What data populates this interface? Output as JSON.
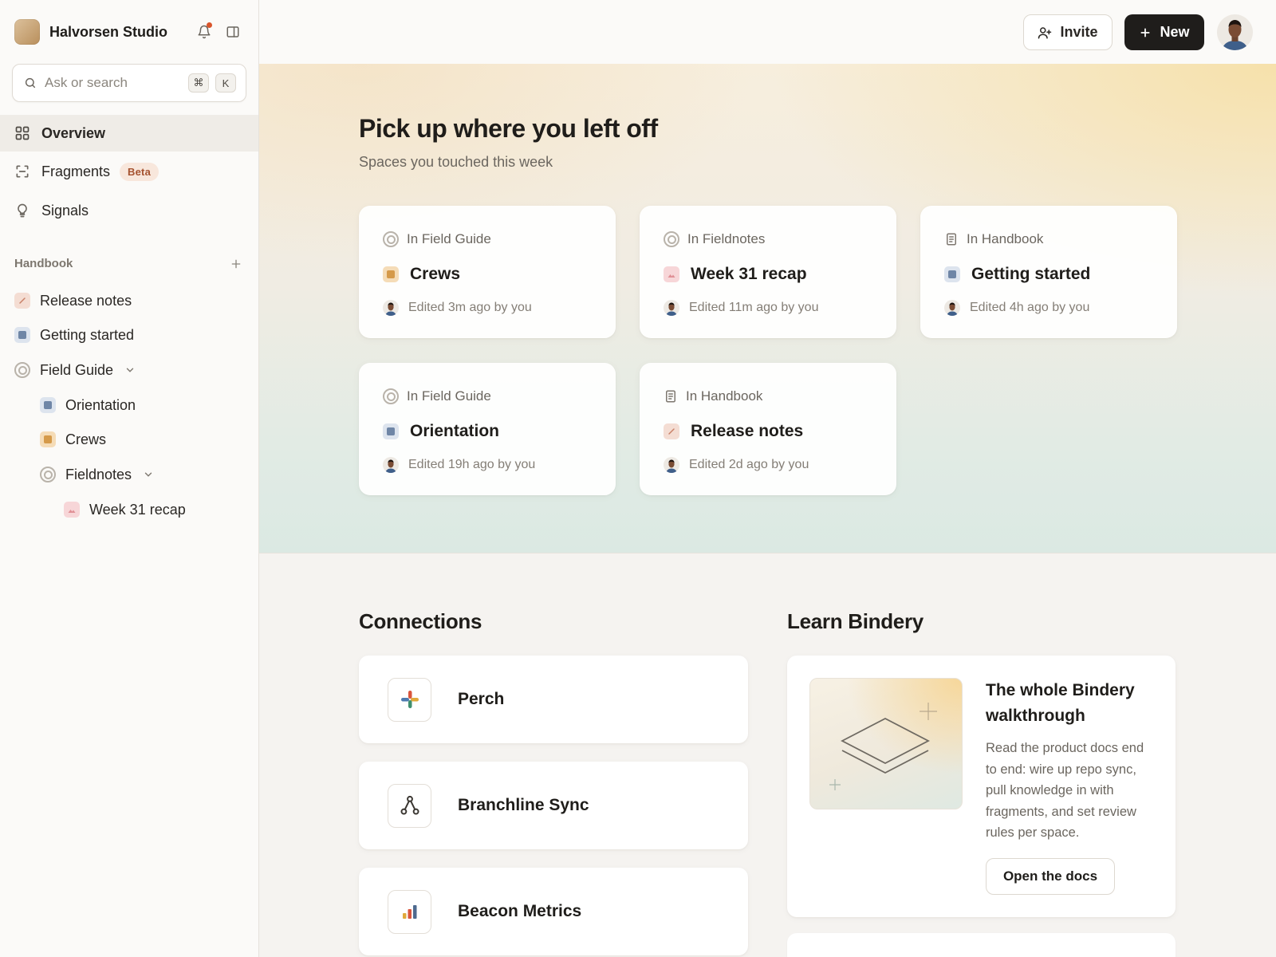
{
  "workspace": {
    "name": "Halvorsen Studio"
  },
  "search": {
    "placeholder": "Ask or search",
    "shortcut_mod": "⌘",
    "shortcut_key": "K"
  },
  "nav": [
    {
      "label": "Overview",
      "icon": "grid-icon",
      "active": true
    },
    {
      "label": "Fragments",
      "icon": "scan-icon",
      "badge": "Beta"
    },
    {
      "label": "Signals",
      "icon": "lightbulb-icon"
    }
  ],
  "sidebar_section": {
    "title": "Handbook"
  },
  "tree": [
    {
      "label": "Release notes",
      "icon": "pencil-page-icon"
    },
    {
      "label": "Getting started",
      "icon": "blue-square-icon"
    },
    {
      "label": "Field Guide",
      "icon": "ring-icon"
    },
    {
      "label": "Orientation",
      "icon": "blue-square-icon"
    },
    {
      "label": "Crews",
      "icon": "orange-square-icon"
    },
    {
      "label": "Fieldnotes",
      "icon": "ring-icon"
    },
    {
      "label": "Week 31 recap",
      "icon": "chart-page-icon"
    }
  ],
  "topbar": {
    "invite_label": "Invite",
    "new_label": "New"
  },
  "hero": {
    "title": "Pick up where you left off",
    "subtitle": "Spaces you touched this week",
    "cards": [
      {
        "context": "In Field Guide",
        "title": "Crews",
        "meta": "Edited 3m ago by you"
      },
      {
        "context": "In Fieldnotes",
        "title": "Week 31 recap",
        "meta": "Edited 11m ago by you"
      },
      {
        "context": "In Handbook",
        "title": "Getting started",
        "meta": "Edited 4h ago by you"
      },
      {
        "context": "In Field Guide",
        "title": "Orientation",
        "meta": "Edited 19h ago by you"
      },
      {
        "context": "In Handbook",
        "title": "Release notes",
        "meta": "Edited 2d ago by you"
      }
    ]
  },
  "connections": {
    "title": "Connections",
    "items": [
      {
        "name": "Perch",
        "icon": "perch-logo-icon"
      },
      {
        "name": "Branchline Sync",
        "icon": "branch-icon"
      },
      {
        "name": "Beacon Metrics",
        "icon": "bar-chart-icon"
      }
    ]
  },
  "learn": {
    "title": "Learn Bindery",
    "card_title": "The whole Bindery walkthrough",
    "card_body": "Read the product docs end to end: wire up repo sync, pull knowledge in with fragments, and set review rules per space.",
    "button_label": "Open the docs"
  },
  "colors": {
    "accent_dark": "#1f1d1b",
    "notification": "#d9552b",
    "beta_text": "#a5522f",
    "beta_bg": "#f8e7dc"
  }
}
